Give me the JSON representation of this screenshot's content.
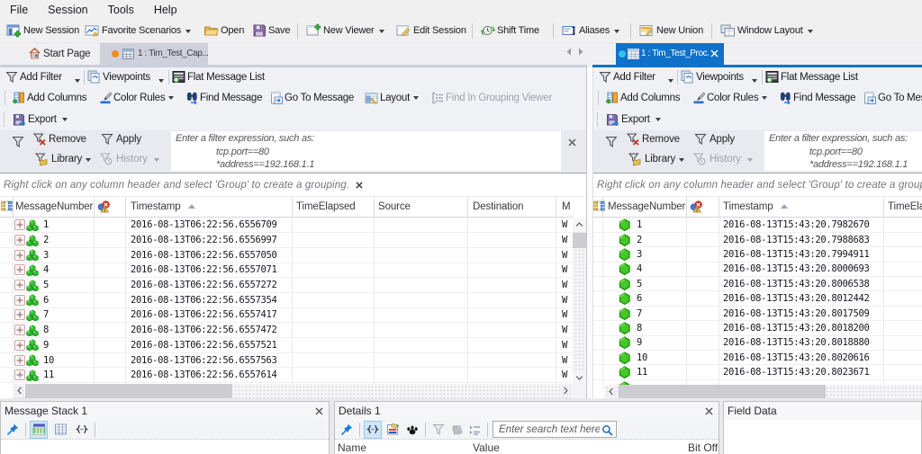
{
  "menu": {
    "items": [
      "File",
      "Session",
      "Tools",
      "Help"
    ]
  },
  "toolbar": {
    "new_session": "New Session",
    "favorite_scenarios": "Favorite Scenarios",
    "open": "Open",
    "save": "Save",
    "new_viewer": "New Viewer",
    "edit_session": "Edit Session",
    "shift_time": "Shift Time",
    "aliases": "Aliases",
    "new_union": "New Union",
    "window_layout": "Window Layout"
  },
  "tabs": {
    "start_page": "Start Page",
    "capture_tab": "1 : Tim_Test_Cap...",
    "process_tab": "1 : Tim_Test_Proc..."
  },
  "viewpoint_bar": {
    "add_filter": "Add Filter",
    "viewpoints": "Viewpoints",
    "flat_message_list": "Flat Message List"
  },
  "actions_bar": {
    "add_columns": "Add Columns",
    "color_rules": "Color Rules",
    "find_message": "Find Message",
    "go_to_message": "Go To Message",
    "layout": "Layout",
    "find_in_grouping_viewer": "Find In Grouping Viewer"
  },
  "export_bar": {
    "export": "Export"
  },
  "filter_bar": {
    "remove": "Remove",
    "apply": "Apply",
    "library": "Library",
    "history": "History",
    "placeholder_line1": "Enter a filter expression, such as:",
    "placeholder_line2": "tcp.port==80",
    "placeholder_line3": "*address==192.168.1.1"
  },
  "grouping_hint": "Right click on any column header and select 'Group' to create a grouping.",
  "left_grid": {
    "columns": {
      "message_number": "MessageNumber",
      "timestamp": "Timestamp",
      "time_elapsed": "TimeElapsed",
      "source": "Source",
      "destination": "Destination",
      "module": "M"
    },
    "rows": [
      {
        "num": "1",
        "timestamp": "2016-08-13T06:22:56.6556709",
        "module": "W"
      },
      {
        "num": "2",
        "timestamp": "2016-08-13T06:22:56.6556997",
        "module": "W"
      },
      {
        "num": "3",
        "timestamp": "2016-08-13T06:22:56.6557050",
        "module": "W"
      },
      {
        "num": "4",
        "timestamp": "2016-08-13T06:22:56.6557071",
        "module": "W"
      },
      {
        "num": "5",
        "timestamp": "2016-08-13T06:22:56.6557272",
        "module": "W"
      },
      {
        "num": "6",
        "timestamp": "2016-08-13T06:22:56.6557354",
        "module": "W"
      },
      {
        "num": "7",
        "timestamp": "2016-08-13T06:22:56.6557417",
        "module": "W"
      },
      {
        "num": "8",
        "timestamp": "2016-08-13T06:22:56.6557472",
        "module": "W"
      },
      {
        "num": "9",
        "timestamp": "2016-08-13T06:22:56.6557521",
        "module": "W"
      },
      {
        "num": "10",
        "timestamp": "2016-08-13T06:22:56.6557563",
        "module": "W"
      },
      {
        "num": "11",
        "timestamp": "2016-08-13T06:22:56.6557614",
        "module": "W"
      },
      {
        "num": "",
        "timestamp": "",
        "module": ""
      }
    ]
  },
  "right_grid": {
    "columns": {
      "message_number": "MessageNumber",
      "timestamp": "Timestamp",
      "time_elapsed": "TimeElapsed"
    },
    "rows": [
      {
        "num": "1",
        "timestamp": "2016-08-13T15:43:20.7982670"
      },
      {
        "num": "2",
        "timestamp": "2016-08-13T15:43:20.7988683"
      },
      {
        "num": "3",
        "timestamp": "2016-08-13T15:43:20.7994911"
      },
      {
        "num": "4",
        "timestamp": "2016-08-13T15:43:20.8000693"
      },
      {
        "num": "5",
        "timestamp": "2016-08-13T15:43:20.8006538"
      },
      {
        "num": "6",
        "timestamp": "2016-08-13T15:43:20.8012442"
      },
      {
        "num": "7",
        "timestamp": "2016-08-13T15:43:20.8017509"
      },
      {
        "num": "8",
        "timestamp": "2016-08-13T15:43:20.8018200"
      },
      {
        "num": "9",
        "timestamp": "2016-08-13T15:43:20.8018880"
      },
      {
        "num": "10",
        "timestamp": "2016-08-13T15:43:20.8020616"
      },
      {
        "num": "11",
        "timestamp": "2016-08-13T15:43:20.8023671"
      },
      {
        "num": "",
        "timestamp": ""
      }
    ]
  },
  "panels": {
    "message_stack": {
      "title": "Message Stack 1"
    },
    "details": {
      "title": "Details 1",
      "search_placeholder": "Enter search text here...",
      "columns": {
        "name": "Name",
        "value": "Value",
        "bit_offset": "Bit Offset"
      }
    },
    "field_data": {
      "title": "Field Data"
    }
  },
  "colors": {
    "accent_blue": "#0f72c8",
    "inactive_tab": "#ced1dc",
    "row_icon_green": "#3db53d",
    "dot_orange": "#ef8f1f",
    "dot_cyan": "#35c3ee"
  }
}
